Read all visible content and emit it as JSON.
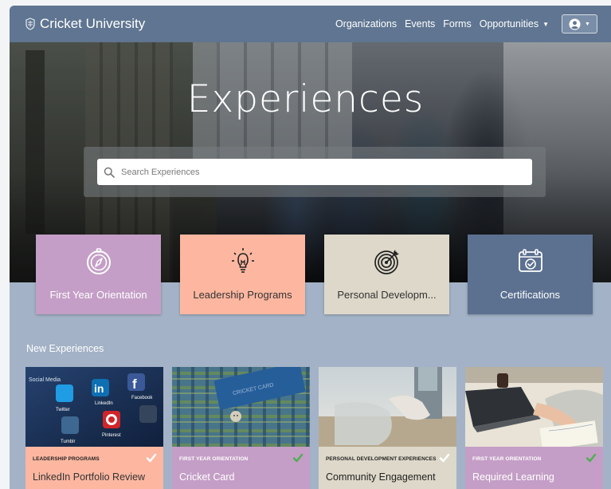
{
  "brand": {
    "name": "Cricket University",
    "logo_icon": "cricket-shield-icon"
  },
  "nav": {
    "links": [
      "Organizations",
      "Events",
      "Forms",
      "Opportunities"
    ],
    "avatar_icon": "user-circle-icon"
  },
  "hero": {
    "title": "Experiences",
    "search_placeholder": "Search Experiences"
  },
  "categories": [
    {
      "label": "First Year Orientation",
      "icon": "compass-icon",
      "bg": "#c49ec6",
      "fg": "#ffffff"
    },
    {
      "label": "Leadership Programs",
      "icon": "lightbulb-icon",
      "bg": "#fdb7a1",
      "fg": "#333333"
    },
    {
      "label": "Personal Developm...",
      "icon": "target-icon",
      "bg": "#ddd8c9",
      "fg": "#333333"
    },
    {
      "label": "Certifications",
      "icon": "calendar-check-icon",
      "bg": "#5c7090",
      "fg": "#ffffff"
    }
  ],
  "section": {
    "title": "New Experiences"
  },
  "cards": [
    {
      "category": "LEADERSHIP PROGRAMS",
      "title": "LinkedIn Portfolio Review",
      "bg": "#fdb7a1",
      "fg": "#333333",
      "check": "#ffffff",
      "image": "social-media-apps"
    },
    {
      "category": "FIRST YEAR ORIENTATION",
      "title": "Cricket Card",
      "bg": "#c49ec6",
      "fg": "#ffffff",
      "check": "#4caf50",
      "image": "id-card-pocket"
    },
    {
      "category": "PERSONAL DEVELOPMENT EXPERIENCES",
      "title": "Community Engagement",
      "bg": "#ddd8c9",
      "fg": "#222222",
      "check": "#ffffff",
      "image": "beach-cleanup"
    },
    {
      "category": "FIRST YEAR ORIENTATION",
      "title": "Required Learning",
      "bg": "#c49ec6",
      "fg": "#ffffff",
      "check": "#4caf50",
      "image": "laptop-notebook"
    }
  ],
  "colors": {
    "nav": "#5f7591",
    "page_bg": "#a3b2c6"
  }
}
